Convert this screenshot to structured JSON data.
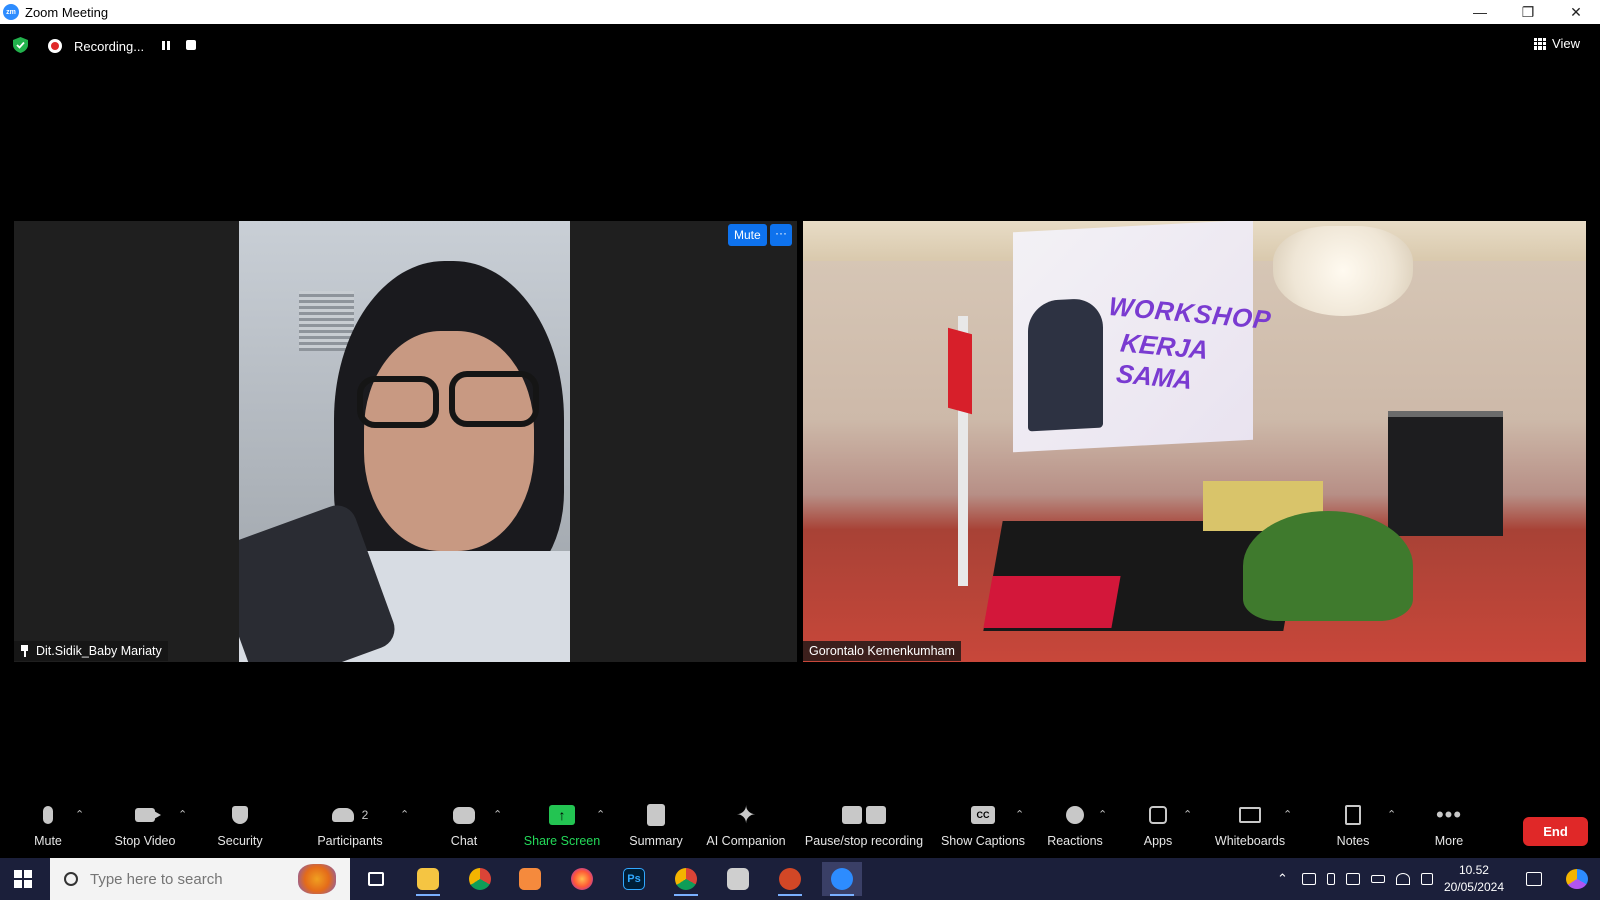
{
  "window": {
    "title": "Zoom Meeting",
    "controls": {
      "minimize": "—",
      "restore": "❐",
      "close": "✕"
    }
  },
  "topbar": {
    "recording_label": "Recording...",
    "view_label": "View"
  },
  "tiles": [
    {
      "name": "Dit.Sidik_Baby Mariaty",
      "pinned": true
    },
    {
      "name": "Gorontalo Kemenkumham",
      "pinned": false
    }
  ],
  "tile_controls": {
    "mute_label": "Mute",
    "more_label": "···"
  },
  "banner": {
    "line1": "WORKSHOP",
    "line2": "KERJA SAMA"
  },
  "toolbar": {
    "mute": "Mute",
    "stop_video": "Stop Video",
    "security": "Security",
    "participants": "Participants",
    "participants_count": "2",
    "chat": "Chat",
    "share_screen": "Share Screen",
    "summary": "Summary",
    "ai_companion": "AI Companion",
    "pause_stop_recording": "Pause/stop recording",
    "show_captions": "Show Captions",
    "captions_glyph": "CC",
    "reactions": "Reactions",
    "apps": "Apps",
    "whiteboards": "Whiteboards",
    "notes": "Notes",
    "more": "More",
    "end": "End"
  },
  "taskbar": {
    "search_placeholder": "Type here to search",
    "time": "10.52",
    "date": "20/05/2024"
  },
  "colors": {
    "accent_blue": "#0e72ed",
    "end_red": "#e02828",
    "share_green": "#23d959",
    "shield_green": "#22b14c",
    "taskbar": "#1b1f3a"
  }
}
